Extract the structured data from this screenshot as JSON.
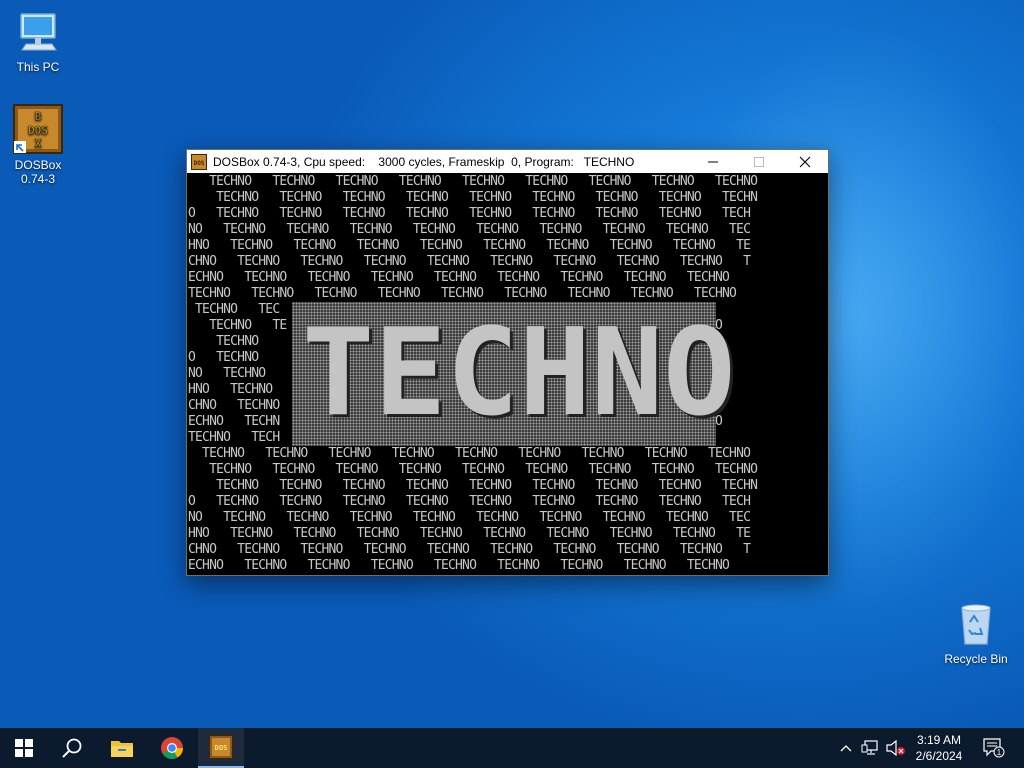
{
  "desktop": {
    "icons": [
      {
        "label": "This PC"
      },
      {
        "label": "DOSBox\n0.74-3"
      },
      {
        "label": "Recycle Bin"
      }
    ]
  },
  "window": {
    "title": "DOSBox 0.74-3, Cpu speed:    3000 cycles, Frameskip  0, Program:   TECHNO",
    "screen_rows": [
      "   TECHNO   TECHNO   TECHNO   TECHNO   TECHNO   TECHNO   TECHNO   TECHNO   TECHNO",
      "    TECHNO   TECHNO   TECHNO   TECHNO   TECHNO   TECHNO   TECHNO   TECHNO   TECHN",
      "O   TECHNO   TECHNO   TECHNO   TECHNO   TECHNO   TECHNO   TECHNO   TECHNO   TECH",
      "NO   TECHNO   TECHNO   TECHNO   TECHNO   TECHNO   TECHNO   TECHNO   TECHNO   TEC",
      "HNO   TECHNO   TECHNO   TECHNO   TECHNO   TECHNO   TECHNO   TECHNO   TECHNO   TE",
      "CHNO   TECHNO   TECHNO   TECHNO   TECHNO   TECHNO   TECHNO   TECHNO   TECHNO   T",
      "ECHNO   TECHNO   TECHNO   TECHNO   TECHNO   TECHNO   TECHNO   TECHNO   TECHNO",
      "TECHNO   TECHNO   TECHNO   TECHNO   TECHNO   TECHNO   TECHNO   TECHNO   TECHNO",
      " TECHNO   TEC                                                 CHNO   TECHNO",
      "   TECHNO   TE                                                ECHNO   TECHNO",
      "    TECHNO                                                    TECHNO   TECHN",
      "O   TECHNO                                                     TECHNO   TECH",
      "NO   TECHNO                                                     TECHNO   TEC",
      "HNO   TECHNO                                                     TECHNO   TE",
      "CHNO   TECHNO                                                     TECHNO   T",
      "ECHNO   TECHN                                                     O   TECHNO",
      "TECHNO   TECH                                                 HNO   TECHNO",
      "  TECHNO   TECHNO   TECHNO   TECHNO   TECHNO   TECHNO   TECHNO   TECHNO   TECHNO",
      "   TECHNO   TECHNO   TECHNO   TECHNO   TECHNO   TECHNO   TECHNO   TECHNO   TECHNO",
      "    TECHNO   TECHNO   TECHNO   TECHNO   TECHNO   TECHNO   TECHNO   TECHNO   TECHN",
      "O   TECHNO   TECHNO   TECHNO   TECHNO   TECHNO   TECHNO   TECHNO   TECHNO   TECH",
      "NO   TECHNO   TECHNO   TECHNO   TECHNO   TECHNO   TECHNO   TECHNO   TECHNO   TEC",
      "HNO   TECHNO   TECHNO   TECHNO   TECHNO   TECHNO   TECHNO   TECHNO   TECHNO   TE",
      "CHNO   TECHNO   TECHNO   TECHNO   TECHNO   TECHNO   TECHNO   TECHNO   TECHNO   T",
      "ECHNO   TECHNO   TECHNO   TECHNO   TECHNO   TECHNO   TECHNO   TECHNO   TECHNO"
    ],
    "banner_letters": [
      "T",
      "E",
      "C",
      "H",
      "N",
      "O"
    ]
  },
  "taskbar": {
    "clock_time": "3:19 AM",
    "clock_date": "2/6/2024",
    "notification_count": "1",
    "pinned": [
      {
        "icon": "windows-start-icon"
      },
      {
        "icon": "search-icon"
      },
      {
        "icon": "file-explorer-icon"
      },
      {
        "icon": "chrome-icon"
      },
      {
        "icon": "dosbox-icon"
      }
    ]
  },
  "colors": {
    "desktop_blue": "#1479d6",
    "taskbar": "#0b1a2c",
    "dos_text": "#c8c8c8"
  }
}
